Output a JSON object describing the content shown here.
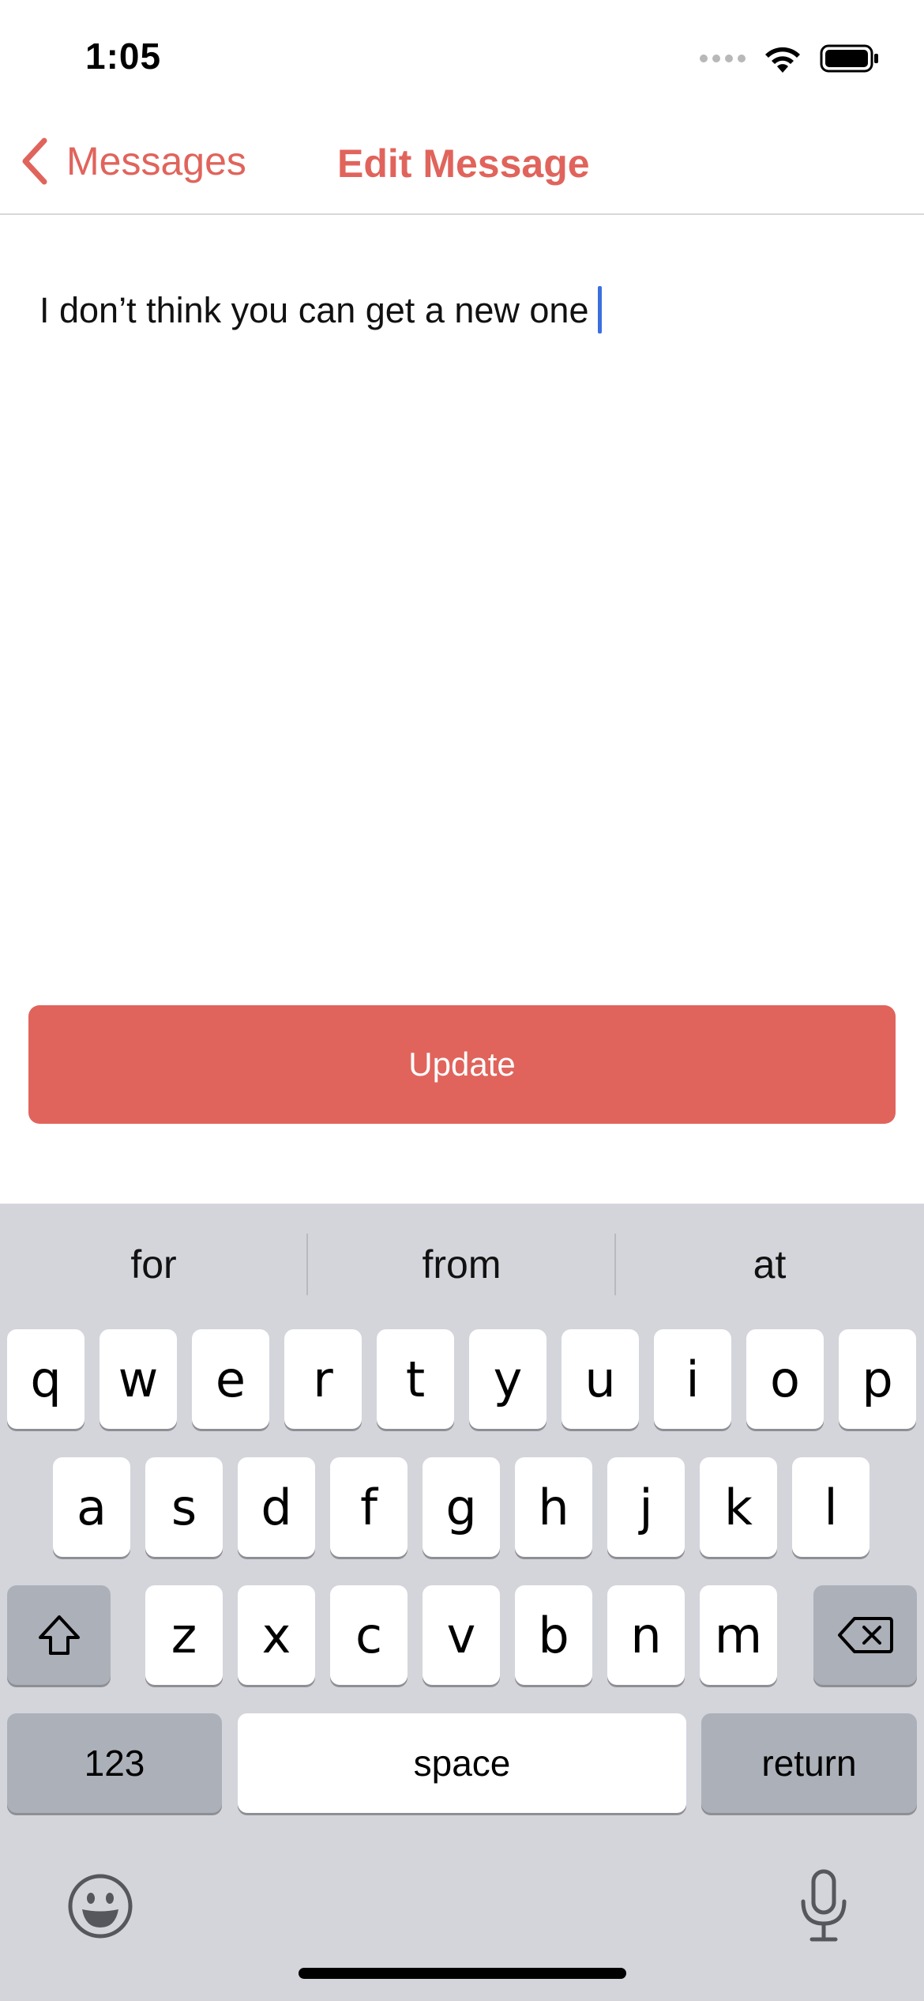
{
  "status_bar": {
    "time": "1:05",
    "icons": [
      "signal-dots-icon",
      "wifi-icon",
      "battery-icon"
    ]
  },
  "nav": {
    "back_label": "Messages",
    "back_icon": "chevron-left-icon",
    "title": "Edit Message",
    "accent_color": "#e0645c"
  },
  "message": {
    "text": "I don’t think you can get a new one"
  },
  "update_button": {
    "label": "Update",
    "color": "#e0645c"
  },
  "keyboard": {
    "suggestions": [
      "for",
      "from",
      "at"
    ],
    "row1": [
      "q",
      "w",
      "e",
      "r",
      "t",
      "y",
      "u",
      "i",
      "o",
      "p"
    ],
    "row2": [
      "a",
      "s",
      "d",
      "f",
      "g",
      "h",
      "j",
      "k",
      "l"
    ],
    "row3": [
      "z",
      "x",
      "c",
      "v",
      "b",
      "n",
      "m"
    ],
    "numbers_label": "123",
    "space_label": "space",
    "return_label": "return",
    "icons": [
      "shift-icon",
      "backspace-icon",
      "emoji-icon",
      "microphone-icon"
    ]
  }
}
